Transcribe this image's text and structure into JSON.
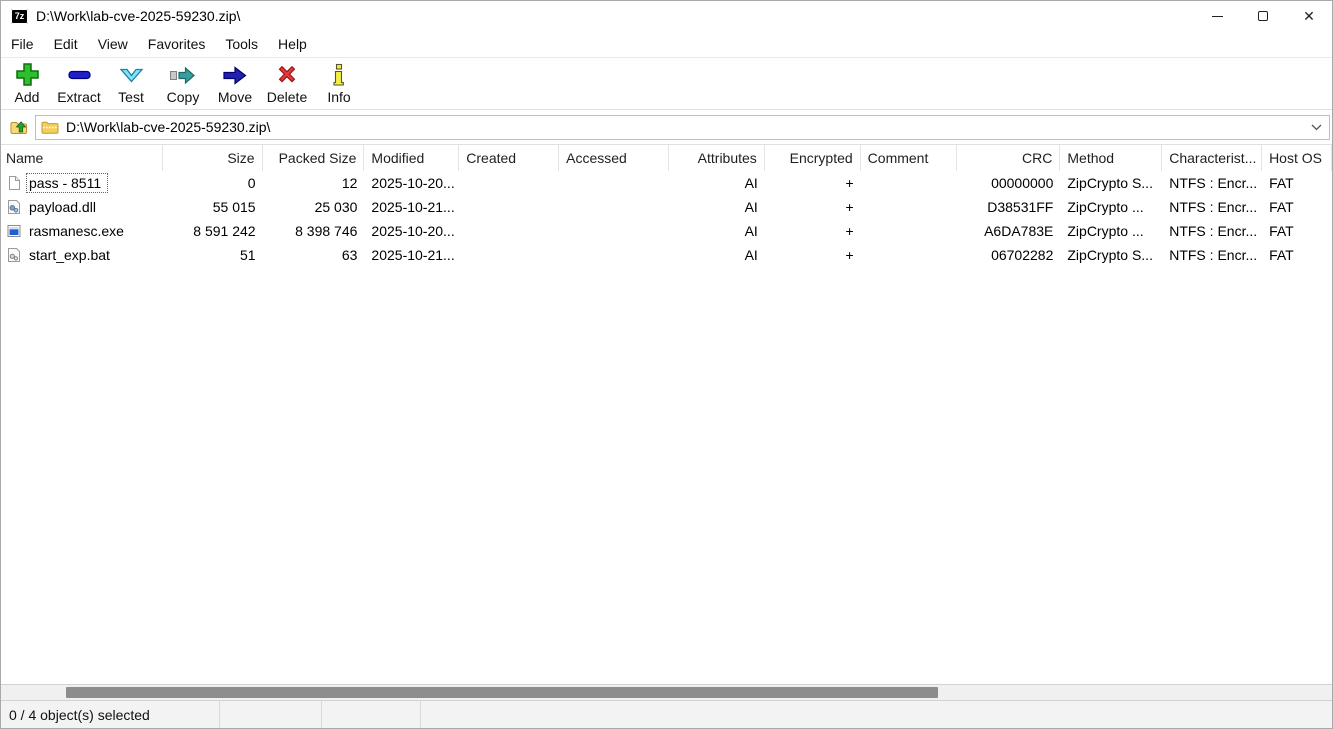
{
  "window": {
    "title": "D:\\Work\\lab-cve-2025-59230.zip\\",
    "app_badge": "7z"
  },
  "menu": {
    "items": [
      "File",
      "Edit",
      "View",
      "Favorites",
      "Tools",
      "Help"
    ]
  },
  "toolbar": {
    "buttons": [
      {
        "label": "Add",
        "icon": "add-plus-icon",
        "color": "#2ebf2e"
      },
      {
        "label": "Extract",
        "icon": "extract-minus-icon",
        "color": "#2020c8"
      },
      {
        "label": "Test",
        "icon": "test-check-icon",
        "color": "#7ae8f0"
      },
      {
        "label": "Copy",
        "icon": "copy-arrow-icon",
        "color": "#3a9d9d"
      },
      {
        "label": "Move",
        "icon": "move-arrow-icon",
        "color": "#2121b0"
      },
      {
        "label": "Delete",
        "icon": "delete-x-icon",
        "color": "#e23b3b"
      },
      {
        "label": "Info",
        "icon": "info-i-icon",
        "color": "#f5ee45"
      }
    ]
  },
  "address": {
    "path": "D:\\Work\\lab-cve-2025-59230.zip\\"
  },
  "table": {
    "columns": [
      {
        "label": "Name"
      },
      {
        "label": "Size"
      },
      {
        "label": "Packed Size"
      },
      {
        "label": "Modified"
      },
      {
        "label": "Created"
      },
      {
        "label": "Accessed"
      },
      {
        "label": "Attributes"
      },
      {
        "label": "Encrypted"
      },
      {
        "label": "Comment"
      },
      {
        "label": "CRC"
      },
      {
        "label": "Method"
      },
      {
        "label": "Characterist..."
      },
      {
        "label": "Host OS"
      }
    ],
    "rows": [
      {
        "name": "pass - 8511",
        "size": "0",
        "packed_size": "12",
        "modified": "2025-10-20...",
        "created": "",
        "accessed": "",
        "attributes": "AI",
        "encrypted": "+",
        "comment": "",
        "crc": "00000000",
        "method": "ZipCrypto S...",
        "characteristics": "NTFS : Encr...",
        "host_os": "FAT"
      },
      {
        "name": "payload.dll",
        "size": "55 015",
        "packed_size": "25 030",
        "modified": "2025-10-21...",
        "created": "",
        "accessed": "",
        "attributes": "AI",
        "encrypted": "+",
        "comment": "",
        "crc": "D38531FF",
        "method": "ZipCrypto ...",
        "characteristics": "NTFS : Encr...",
        "host_os": "FAT"
      },
      {
        "name": "rasmanesc.exe",
        "size": "8 591 242",
        "packed_size": "8 398 746",
        "modified": "2025-10-20...",
        "created": "",
        "accessed": "",
        "attributes": "AI",
        "encrypted": "+",
        "comment": "",
        "crc": "A6DA783E",
        "method": "ZipCrypto ...",
        "characteristics": "NTFS : Encr...",
        "host_os": "FAT"
      },
      {
        "name": "start_exp.bat",
        "size": "51",
        "packed_size": "63",
        "modified": "2025-10-21...",
        "created": "",
        "accessed": "",
        "attributes": "AI",
        "encrypted": "+",
        "comment": "",
        "crc": "06702282",
        "method": "ZipCrypto S...",
        "characteristics": "NTFS : Encr...",
        "host_os": "FAT"
      }
    ]
  },
  "status_bar": {
    "selection": "0 / 4 object(s) selected"
  }
}
